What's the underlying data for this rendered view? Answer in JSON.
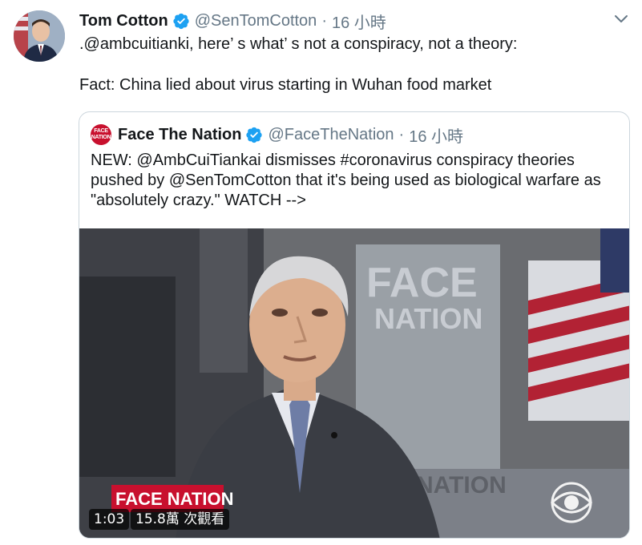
{
  "tweet": {
    "author_name": "Tom Cotton",
    "handle": "@SenTomCotton",
    "separator": "·",
    "time": "16 小時",
    "line1": ".@ambcuitianki, here’ s what’ s not a conspiracy, not a theory:",
    "line2": "Fact: China lied about virus starting in Wuhan food market",
    "icons": {
      "avatar": "avatar",
      "verified": "verified-badge-icon",
      "menu": "chevron-down-icon"
    }
  },
  "quote": {
    "author_name": "Face The Nation",
    "handle": "@FaceTheNation",
    "separator": "·",
    "time": "16 小時",
    "logo_top": "FACE",
    "logo_bottom": "NATION",
    "text": "NEW: @AmbCuiTiankai dismisses #coronavirus conspiracy theories pushed by @SenTomCotton that it's being used as biological warfare as \"absolutely crazy.\" WATCH -->",
    "video": {
      "duration": "1:03",
      "views": "15.8萬 次觀看",
      "backdrop_sign_top": "FACE",
      "backdrop_sign_bottom": "NATION",
      "lower_third": "FACE NATION",
      "side_sign": "NATION"
    }
  },
  "colors": {
    "text": "#14171a",
    "secondary": "#657786",
    "verified": "#1da1f2",
    "border": "#ccd6dd",
    "brand_red": "#c8102e"
  }
}
